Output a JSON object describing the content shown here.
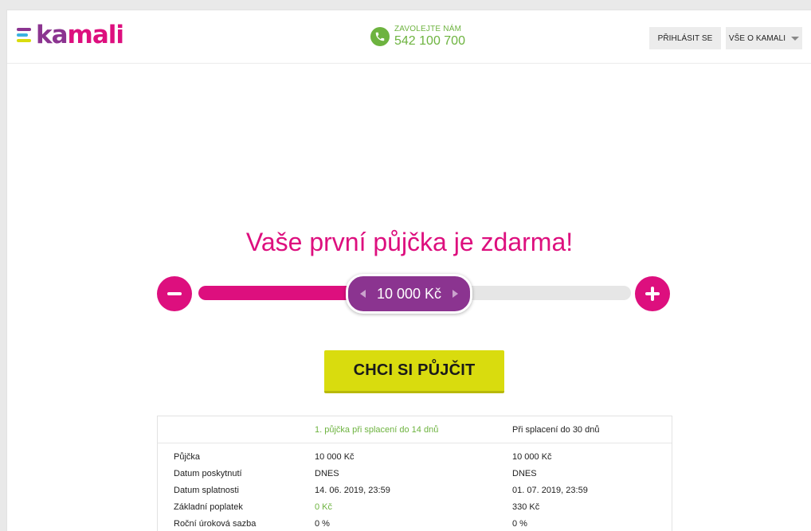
{
  "brand": {
    "name": "kamali",
    "colors": {
      "primary": "#dd0f7e",
      "purple": "#8b3490",
      "green": "#6db33f",
      "yellow": "#d9dc0e"
    }
  },
  "header": {
    "phone": {
      "cta": "ZAVOLEJTE NÁM",
      "number": "542 100 700",
      "icon": "phone-icon"
    },
    "login_label": "PŘIHLÁSIT SE",
    "about_label": "VŠE O KAMALI"
  },
  "main": {
    "headline": "Vaše první půjčka je zdarma!",
    "slider": {
      "value_label": "10 000 Kč",
      "fill_fraction": 0.37
    },
    "cta_label": "CHCI SI PŮJČIT"
  },
  "loan_table": {
    "headers": [
      "",
      "1. půjčka při splacení do 14 dnů",
      "Při splacení do 30 dnů"
    ],
    "rows": [
      [
        "Půjčka",
        "10 000 Kč",
        "10 000 Kč"
      ],
      [
        "Datum poskytnutí",
        "DNES",
        "DNES"
      ],
      [
        "Datum splatnosti",
        "14. 06. 2019, 23:59",
        "01. 07. 2019, 23:59"
      ],
      [
        "Základní poplatek",
        "0 Kč",
        "330 Kč"
      ],
      [
        "Roční úroková sazba",
        "0 %",
        "0 %"
      ]
    ]
  }
}
